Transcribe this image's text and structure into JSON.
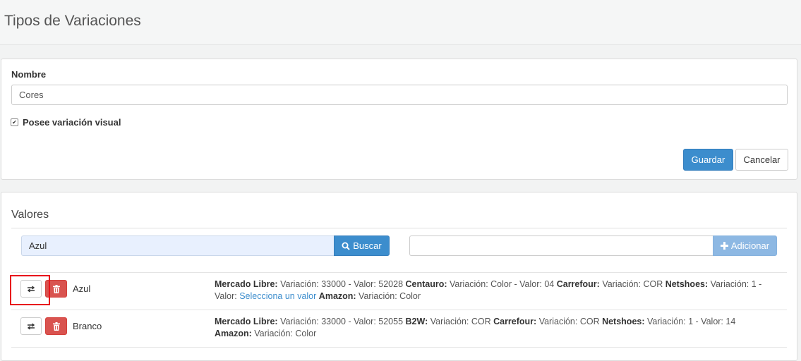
{
  "page": {
    "title": "Tipos de Variaciones"
  },
  "form": {
    "nombre_label": "Nombre",
    "nombre_value": "Cores",
    "visual_label": "Posee variación visual",
    "visual_checked": true,
    "guardar_label": "Guardar",
    "cancelar_label": "Cancelar"
  },
  "values": {
    "section_title": "Valores",
    "search_value": "Azul",
    "buscar_label": "Buscar",
    "add_value": "",
    "adicionar_label": "Adicionar",
    "rows": [
      {
        "name": "Azul",
        "line1": [
          {
            "b": "Mercado Libre:"
          },
          {
            "t": " Variación: 33000 - Valor: 52028 "
          },
          {
            "b": "Centauro:"
          },
          {
            "t": " Variación: Color - Valor: 04 "
          },
          {
            "b": "Carrefour:"
          },
          {
            "t": " Variación: COR "
          },
          {
            "b": "Netshoes:"
          },
          {
            "t": " Variación: 1 -"
          }
        ],
        "line2": [
          {
            "t": "Valor: "
          },
          {
            "l": "Selecciona un valor"
          },
          {
            "t": " "
          },
          {
            "b": "Amazon:"
          },
          {
            "t": " Variación: Color"
          }
        ]
      },
      {
        "name": "Branco",
        "line1": [
          {
            "b": "Mercado Libre:"
          },
          {
            "t": " Variación: 33000 - Valor: 52055 "
          },
          {
            "b": "B2W:"
          },
          {
            "t": " Variación: COR "
          },
          {
            "b": "Carrefour:"
          },
          {
            "t": " Variación: COR "
          },
          {
            "b": "Netshoes:"
          },
          {
            "t": " Variación: 1 - Valor: 14"
          }
        ],
        "line2": [
          {
            "b": "Amazon:"
          },
          {
            "t": " Variación: Color"
          }
        ]
      }
    ]
  },
  "colors": {
    "primary": "#3c8dcd",
    "danger": "#d9534f",
    "highlight": "#e8141c"
  },
  "icons": {
    "swap": "swap-arrows-icon",
    "trash": "trash-icon",
    "search": "search-icon",
    "plus": "plus-icon"
  }
}
